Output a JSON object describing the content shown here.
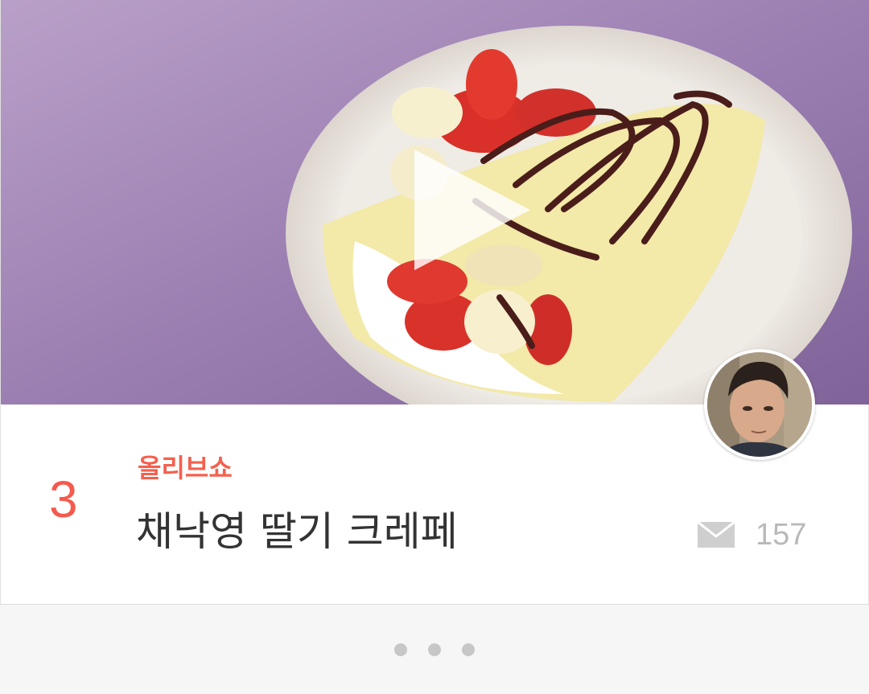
{
  "item": {
    "rank": "3",
    "category": "올리브쇼",
    "title": "채낙영 딸기 크레페",
    "comment_count": "157",
    "comment_icon": "envelope-icon",
    "play_icon": "play-icon"
  },
  "pager": {
    "dot_count": 3
  },
  "colors": {
    "accent": "#f55a4e",
    "background": "#f6f6f6",
    "muted": "#b9b9b9"
  }
}
